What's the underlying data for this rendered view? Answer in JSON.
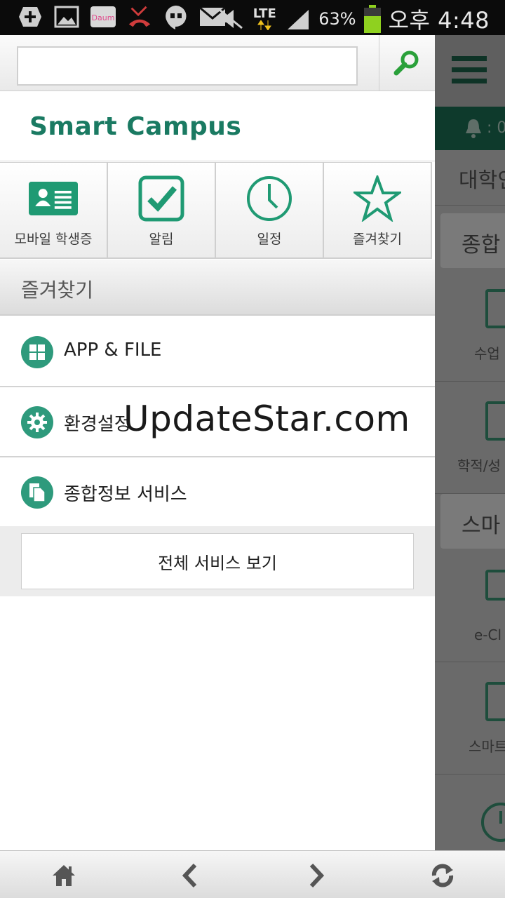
{
  "status_bar": {
    "left_icons": [
      "plus-icon",
      "picture-icon",
      "daum-app-icon",
      "missed-call-icon",
      "hangouts-icon",
      "mail-icon"
    ],
    "right_icons": [
      "mute-icon",
      "lte-icon",
      "signal-icon",
      "battery-icon"
    ],
    "network": "LTE",
    "battery_percent": "63%",
    "time": "오후 4:48"
  },
  "search": {
    "placeholder": "",
    "value": "",
    "icon": "search-icon"
  },
  "brand": {
    "title": "Smart Campus"
  },
  "quick_menu": [
    {
      "label": "모바일 학생증",
      "icon": "student-id-icon"
    },
    {
      "label": "알림",
      "icon": "check-icon"
    },
    {
      "label": "일정",
      "icon": "clock-icon"
    },
    {
      "label": "즐겨찾기",
      "icon": "star-icon"
    }
  ],
  "favorites": {
    "header": "즐겨찾기",
    "items": [
      {
        "label": "APP & FILE",
        "icon": "grid-icon"
      },
      {
        "label": "환경설정",
        "icon": "gear-icon"
      },
      {
        "label": "종합정보 서비스",
        "icon": "document-icon"
      }
    ],
    "all_services_label": "전체 서비스 보기"
  },
  "watermark": "UpdateStar.com",
  "background_page": {
    "bell_text": ": 0",
    "title_fragment": "대학인",
    "section1": "종합",
    "item1": "수업",
    "item2": "학적/성",
    "section2": "스마",
    "item3": "e-Cl",
    "item4": "스마트"
  },
  "bottom_bar": [
    "home-icon",
    "back-icon",
    "forward-icon",
    "refresh-icon"
  ],
  "colors": {
    "accent": "#1a7a62",
    "icon_circle": "#2e9a7c",
    "status_bar": "#0b0b0b"
  }
}
